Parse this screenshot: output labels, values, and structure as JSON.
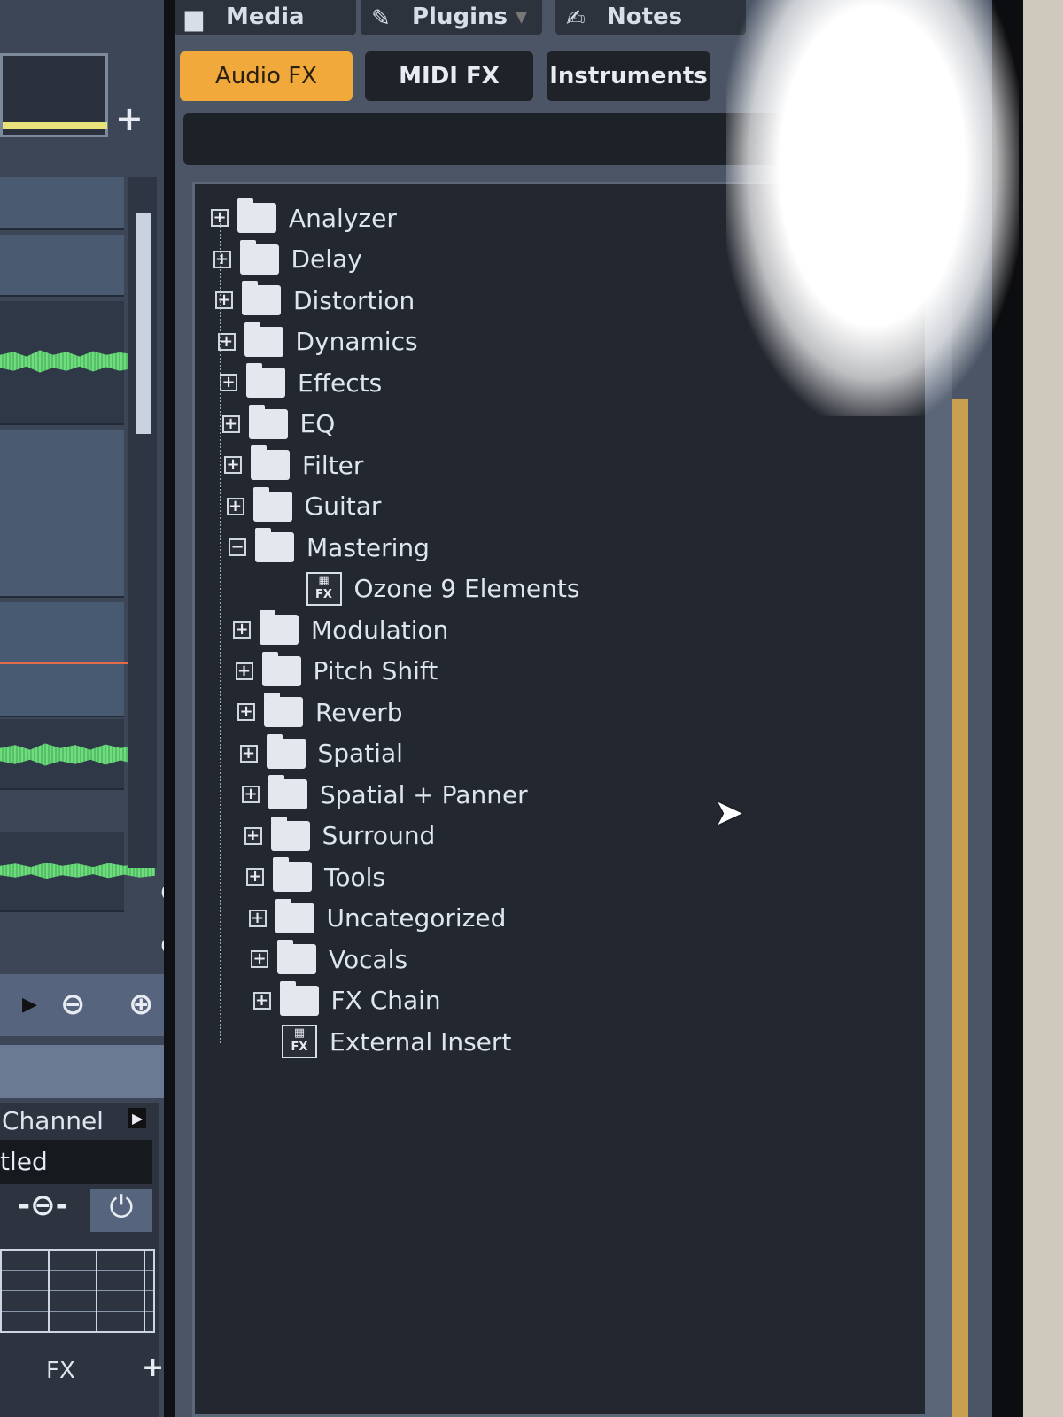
{
  "top_tabs": [
    {
      "label": "Media",
      "icon": "folder-icon"
    },
    {
      "label": "Plugins",
      "icon": "plug-icon"
    },
    {
      "label": "Notes",
      "icon": "notepad-icon"
    }
  ],
  "category_tabs": [
    {
      "label": "Audio FX",
      "active": true
    },
    {
      "label": "MIDI FX",
      "active": false
    },
    {
      "label": "Instruments",
      "active": false
    }
  ],
  "search": {
    "value": "",
    "placeholder": ""
  },
  "tree": [
    {
      "label": "Analyzer",
      "type": "folder",
      "expanded": false
    },
    {
      "label": "Delay",
      "type": "folder",
      "expanded": false
    },
    {
      "label": "Distortion",
      "type": "folder",
      "expanded": false
    },
    {
      "label": "Dynamics",
      "type": "folder",
      "expanded": false
    },
    {
      "label": "Effects",
      "type": "folder",
      "expanded": false
    },
    {
      "label": "EQ",
      "type": "folder",
      "expanded": false
    },
    {
      "label": "Filter",
      "type": "folder",
      "expanded": false
    },
    {
      "label": "Guitar",
      "type": "folder",
      "expanded": false
    },
    {
      "label": "Mastering",
      "type": "folder",
      "expanded": true
    },
    {
      "label": "Ozone 9 Elements",
      "type": "plugin",
      "child": true
    },
    {
      "label": "Modulation",
      "type": "folder",
      "expanded": false
    },
    {
      "label": "Pitch Shift",
      "type": "folder",
      "expanded": false
    },
    {
      "label": "Reverb",
      "type": "folder",
      "expanded": false
    },
    {
      "label": "Spatial",
      "type": "folder",
      "expanded": false
    },
    {
      "label": "Spatial + Panner",
      "type": "folder",
      "expanded": false
    },
    {
      "label": "Surround",
      "type": "folder",
      "expanded": false
    },
    {
      "label": "Tools",
      "type": "folder",
      "expanded": false
    },
    {
      "label": "Uncategorized",
      "type": "folder",
      "expanded": false
    },
    {
      "label": "Vocals",
      "type": "folder",
      "expanded": false
    },
    {
      "label": "FX Chain",
      "type": "folder",
      "expanded": false
    },
    {
      "label": "External Insert",
      "type": "plugin",
      "child": false
    }
  ],
  "left_panel": {
    "channel_label": "Channel",
    "track_name": "tled",
    "fx_label": "FX",
    "add": "+",
    "plus": "+"
  },
  "colors": {
    "accent": "#f2a93b",
    "waveform": "#6fdc7e",
    "panel": "#23272f"
  }
}
